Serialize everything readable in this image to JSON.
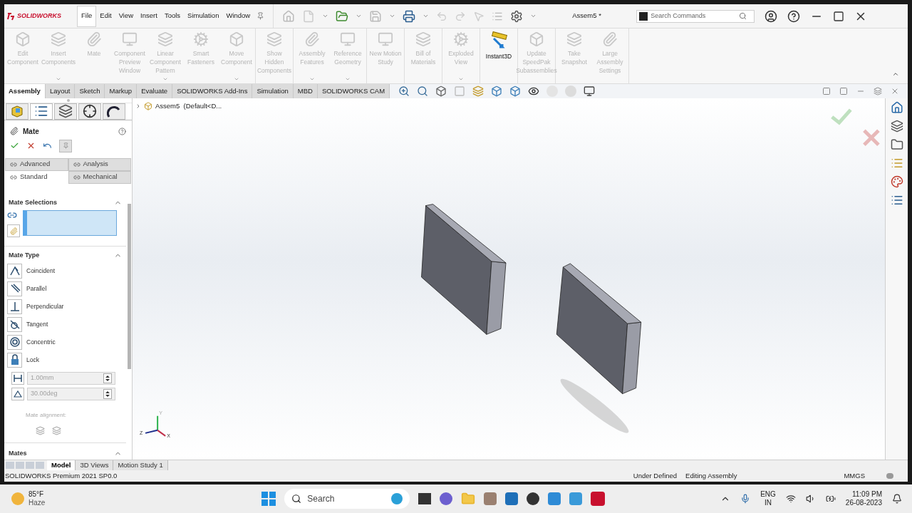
{
  "app": {
    "logo": "SOLIDWORKS",
    "title": "Assem5 *"
  },
  "menu": [
    {
      "label": "File",
      "selected": true
    },
    {
      "label": "Edit",
      "selected": false
    },
    {
      "label": "View",
      "selected": false
    },
    {
      "label": "Insert",
      "selected": false
    },
    {
      "label": "Tools",
      "selected": false
    },
    {
      "label": "Simulation",
      "selected": false
    },
    {
      "label": "Window",
      "selected": false
    }
  ],
  "search": {
    "placeholder": "Search Commands"
  },
  "ribbon": [
    {
      "items": [
        {
          "label": "Edit Component",
          "disabled": true,
          "dropdown": false
        },
        {
          "label": "Insert Components",
          "disabled": true,
          "dropdown": true
        },
        {
          "label": "Mate",
          "disabled": true,
          "dropdown": false
        },
        {
          "label": "Component Preview Window",
          "disabled": true,
          "dropdown": false
        },
        {
          "label": "Linear Component Pattern",
          "disabled": true,
          "dropdown": true
        },
        {
          "label": "Smart Fasteners",
          "disabled": true,
          "dropdown": false
        },
        {
          "label": "Move Component",
          "disabled": true,
          "dropdown": true
        }
      ]
    },
    {
      "items": [
        {
          "label": "Show Hidden Components",
          "disabled": true,
          "dropdown": false
        }
      ]
    },
    {
      "items": [
        {
          "label": "Assembly Features",
          "disabled": true,
          "dropdown": true
        },
        {
          "label": "Reference Geometry",
          "disabled": true,
          "dropdown": true
        }
      ]
    },
    {
      "items": [
        {
          "label": "New Motion Study",
          "disabled": true,
          "dropdown": false
        }
      ]
    },
    {
      "items": [
        {
          "label": "Bill of Materials",
          "disabled": true,
          "dropdown": false
        }
      ]
    },
    {
      "items": [
        {
          "label": "Exploded View",
          "disabled": true,
          "dropdown": true
        }
      ]
    },
    {
      "items": [
        {
          "label": "Instant3D",
          "disabled": false,
          "dropdown": false
        }
      ]
    },
    {
      "items": [
        {
          "label": "Update SpeedPak Subassemblies",
          "disabled": true,
          "dropdown": false
        }
      ]
    },
    {
      "items": [
        {
          "label": "Take Snapshot",
          "disabled": true,
          "dropdown": false
        },
        {
          "label": "Large Assembly Settings",
          "disabled": true,
          "dropdown": false
        }
      ]
    }
  ],
  "command_tabs": [
    {
      "label": "Assembly",
      "selected": true
    },
    {
      "label": "Layout",
      "selected": false
    },
    {
      "label": "Sketch",
      "selected": false
    },
    {
      "label": "Markup",
      "selected": false
    },
    {
      "label": "Evaluate",
      "selected": false
    },
    {
      "label": "SOLIDWORKS Add-Ins",
      "selected": false
    },
    {
      "label": "Simulation",
      "selected": false
    },
    {
      "label": "MBD",
      "selected": false
    },
    {
      "label": "SOLIDWORKS CAM",
      "selected": false
    }
  ],
  "panel_tabs": [
    {
      "selected": false
    },
    {
      "selected": true
    },
    {
      "selected": false
    },
    {
      "selected": false
    },
    {
      "selected": false
    }
  ],
  "property_manager": {
    "title": "Mate",
    "option_tabs": [
      {
        "label": "Advanced",
        "selected": false
      },
      {
        "label": "Analysis",
        "selected": false
      },
      {
        "label": "Standard",
        "selected": true
      },
      {
        "label": "Mechanical",
        "selected": false
      }
    ],
    "selections_title": "Mate Selections",
    "type_title": "Mate Type",
    "mate_types": [
      {
        "kind": "coincident",
        "label": "Coincident"
      },
      {
        "kind": "parallel",
        "label": "Parallel"
      },
      {
        "kind": "perpendicular",
        "label": "Perpendicular"
      },
      {
        "kind": "tangent",
        "label": "Tangent"
      },
      {
        "kind": "concentric",
        "label": "Concentric"
      },
      {
        "kind": "lock",
        "label": "Lock"
      }
    ],
    "distance": {
      "value": "1.00mm",
      "disabled": true
    },
    "angle": {
      "value": "30.00deg",
      "disabled": true
    },
    "alignment_label": "Mate alignment:",
    "mates_title": "Mates"
  },
  "feature_tree": {
    "label": "Assem5  (Default<D..."
  },
  "triad": {
    "y": "Y",
    "z": "Z",
    "x": "X"
  },
  "bottom_tabs": [
    {
      "label": "Model",
      "selected": true
    },
    {
      "label": "3D Views",
      "selected": false
    },
    {
      "label": "Motion Study 1",
      "selected": false
    }
  ],
  "status_bar": {
    "product": "SOLIDWORKS Premium 2021 SP0.0",
    "state": "Under Defined",
    "mode": "Editing Assembly",
    "units": "MMGS"
  },
  "taskbar": {
    "temperature": "85°F",
    "weather": "Haze",
    "search": {
      "placeholder": "Search"
    },
    "language": "ENG",
    "region": "IN",
    "time": "11:09 PM",
    "date": "26-08-2023"
  }
}
